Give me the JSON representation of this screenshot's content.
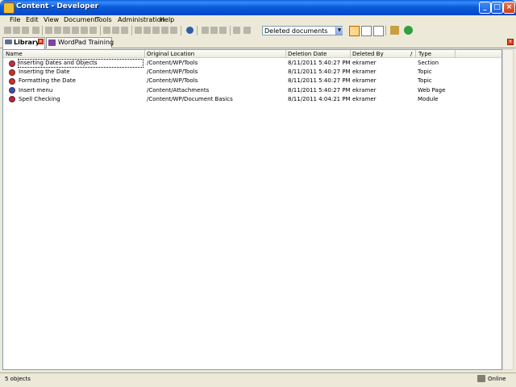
{
  "window": {
    "title": "Content - Developer"
  },
  "menu": [
    "File",
    "Edit",
    "View",
    "Document",
    "Tools",
    "Administration",
    "Help"
  ],
  "toolbar": {
    "filter_value": "Deleted documents"
  },
  "tabs": [
    {
      "label": "Library",
      "active": true
    },
    {
      "label": "WordPad Training",
      "active": false
    }
  ],
  "columns": [
    "Name",
    "Original Location",
    "Deletion Date",
    "Deleted By",
    "Type"
  ],
  "sort_indicator": "/",
  "rows": [
    {
      "name": "Inserting Dates and Objects",
      "location": "/Content/WP/Tools",
      "date": "8/11/2011 5:40:27 PM",
      "by": "ekramer",
      "type": "Section",
      "icon": "section-icon",
      "color": "#c03040"
    },
    {
      "name": "Inserting the Date",
      "location": "/Content/WP/Tools",
      "date": "8/11/2011 5:40:27 PM",
      "by": "ekramer",
      "type": "Topic",
      "icon": "topic-icon",
      "color": "#d03020"
    },
    {
      "name": "Formatting the Date",
      "location": "/Content/WP/Tools",
      "date": "8/11/2011 5:40:27 PM",
      "by": "ekramer",
      "type": "Topic",
      "icon": "topic-icon",
      "color": "#d03020"
    },
    {
      "name": "Insert menu",
      "location": "/Content/Attachments",
      "date": "8/11/2011 5:40:27 PM",
      "by": "ekramer",
      "type": "Web Page",
      "icon": "web-page-icon",
      "color": "#3050c0"
    },
    {
      "name": "Spell Checking",
      "location": "/Content/WP/Document Basics",
      "date": "8/11/2011 4:04:21 PM",
      "by": "ekramer",
      "type": "Module",
      "icon": "module-icon",
      "color": "#c02040"
    }
  ],
  "status": {
    "count": "5 objects",
    "connection": "Online"
  },
  "colors": {
    "titlebar": "#0A5FE8",
    "selection": "#ffd88a"
  }
}
